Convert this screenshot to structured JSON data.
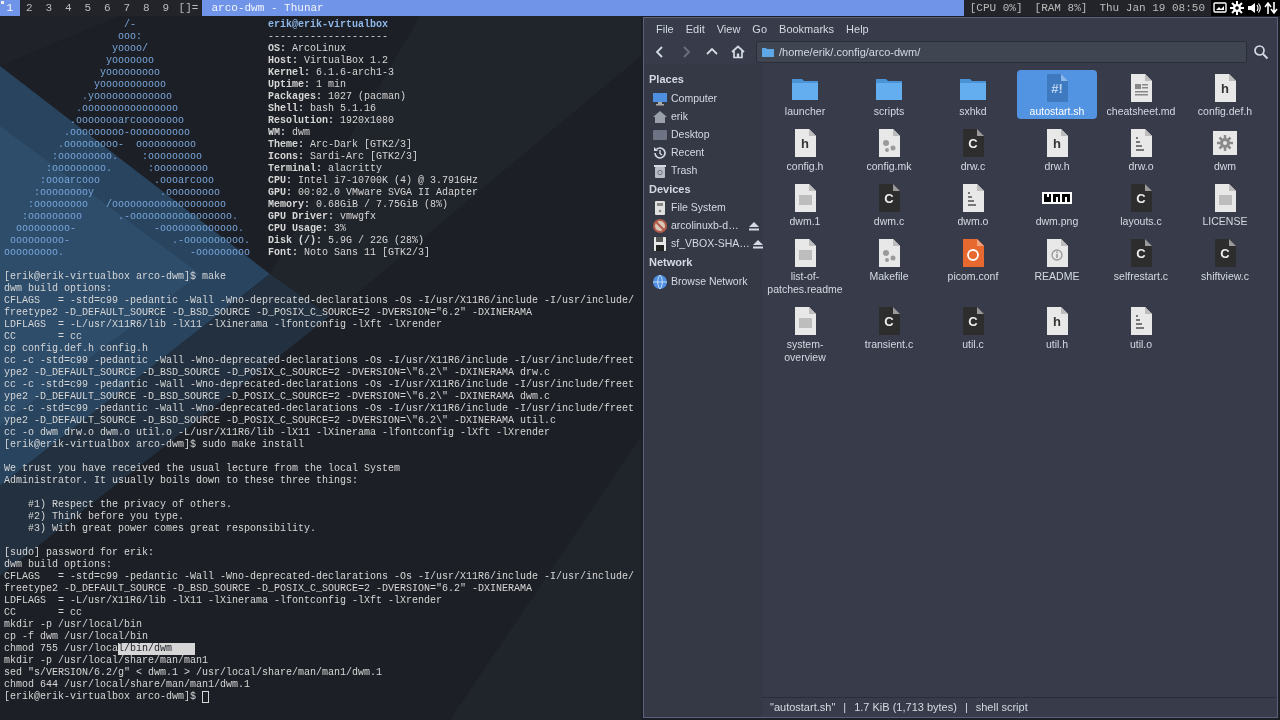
{
  "top_bar": {
    "tags": [
      {
        "label": "1",
        "selected": true,
        "occupied": true
      },
      {
        "label": "2",
        "selected": false,
        "occupied": false
      },
      {
        "label": "3",
        "selected": false,
        "occupied": false
      },
      {
        "label": "4",
        "selected": false,
        "occupied": false
      },
      {
        "label": "5",
        "selected": false,
        "occupied": false
      },
      {
        "label": "6",
        "selected": false,
        "occupied": false
      },
      {
        "label": "7",
        "selected": false,
        "occupied": false
      },
      {
        "label": "8",
        "selected": false,
        "occupied": false
      },
      {
        "label": "9",
        "selected": false,
        "occupied": false
      }
    ],
    "layout": "[]=",
    "window_title": "arco-dwm - Thunar",
    "status": [
      "[CPU 0%]",
      "[RAM 8%]",
      "Thu Jan 19 08:50"
    ],
    "tray": [
      {
        "kind": "screen"
      },
      {
        "kind": "gear"
      },
      {
        "kind": "volume"
      },
      {
        "kind": "network"
      }
    ]
  },
  "terminal": {
    "logo_lines": [
      "                    /-",
      "                   ooo:",
      "                  yoooo/",
      "                 yooooooo",
      "                yooooooooo",
      "               yooooooooooo",
      "             .yooooooooooooo",
      "            .oooooooooooooooo",
      "           .oooooooarcoooooooo",
      "          .ooooooooo-oooooooooo",
      "         .ooooooooo-  oooooooooo",
      "        :ooooooooo.    :ooooooooo",
      "       :ooooooooo.      :ooooooooo",
      "      :oooarcooo         .oooarcooo",
      "     :ooooooooy           .ooooooooo",
      "    :ooooooooo   /ooooooooooooooooooo",
      "   :ooooooooo      .-ooooooooooooooooo.",
      "  ooooooooo-             -ooooooooooooo.",
      " ooooooooo-                 .-oooooooooo.",
      "ooooooooo.                     -ooooooooo"
    ],
    "info_title": "erik@erik-virtualbox",
    "info_divider": "--------------------",
    "info_lines": [
      "**OS:** ArcoLinux",
      "**Host:** VirtualBox 1.2",
      "**Kernel:** 6.1.6-arch1-3",
      "**Uptime:** 1 min",
      "**Packages:** 1027 (pacman)",
      "**Shell:** bash 5.1.16",
      "**Resolution:** 1920x1080",
      "**WM:** dwm",
      "**Theme:** Arc-Dark [GTK2/3]",
      "**Icons:** Sardi-Arc [GTK2/3]",
      "**Terminal:** alacritty",
      "**CPU:** Intel i7-10700K (4) @ 3.791GHz",
      "**GPU:** 00:02.0 VMware SVGA II Adapter",
      "**Memory:** 0.68GiB / 7.75GiB (8%)",
      "**GPU Driver:** vmwgfx",
      "**CPU Usage:** 3%",
      "**Disk (/):** 5.9G / 22G (28%)",
      "**Font:** Noto Sans 11 [GTK2/3]"
    ],
    "blocks": [
      [
        "[erik@erik-virtualbox arco-dwm]$ make",
        "dwm build options:",
        "CFLAGS   = -std=c99 -pedantic -Wall -Wno-deprecated-declarations -Os -I/usr/X11R6/include -I/usr/include/",
        "freetype2 -D_DEFAULT_SOURCE -D_BSD_SOURCE -D_POSIX_C_SOURCE=2 -DVERSION=\"6.2\" -DXINERAMA",
        "LDFLAGS  = -L/usr/X11R6/lib -lX11 -lXinerama -lfontconfig -lXft -lXrender",
        "CC       = cc",
        "cp config.def.h config.h",
        "cc -c -std=c99 -pedantic -Wall -Wno-deprecated-declarations -Os -I/usr/X11R6/include -I/usr/include/freet",
        "ype2 -D_DEFAULT_SOURCE -D_BSD_SOURCE -D_POSIX_C_SOURCE=2 -DVERSION=\\\"6.2\\\" -DXINERAMA drw.c",
        "cc -c -std=c99 -pedantic -Wall -Wno-deprecated-declarations -Os -I/usr/X11R6/include -I/usr/include/freet",
        "ype2 -D_DEFAULT_SOURCE -D_BSD_SOURCE -D_POSIX_C_SOURCE=2 -DVERSION=\\\"6.2\\\" -DXINERAMA dwm.c",
        "cc -c -std=c99 -pedantic -Wall -Wno-deprecated-declarations -Os -I/usr/X11R6/include -I/usr/include/freet",
        "ype2 -D_DEFAULT_SOURCE -D_BSD_SOURCE -D_POSIX_C_SOURCE=2 -DVERSION=\\\"6.2\\\" -DXINERAMA util.c",
        "cc -o dwm drw.o dwm.o util.o -L/usr/X11R6/lib -lX11 -lXinerama -lfontconfig -lXft -lXrender",
        "[erik@erik-virtualbox arco-dwm]$ sudo make install"
      ],
      [
        "We trust you have received the usual lecture from the local System",
        "Administrator. It usually boils down to these three things:"
      ],
      [
        "    #1) Respect the privacy of others.",
        "    #2) Think before you type.",
        "    #3) With great power comes great responsibility."
      ],
      [
        "[sudo] password for erik:",
        "dwm build options:",
        "CFLAGS   = -std=c99 -pedantic -Wall -Wno-deprecated-declarations -Os -I/usr/X11R6/include -I/usr/include/",
        "freetype2 -D_DEFAULT_SOURCE -D_BSD_SOURCE -D_POSIX_C_SOURCE=2 -DVERSION=\"6.2\" -DXINERAMA",
        "LDFLAGS  = -L/usr/X11R6/lib -lX11 -lXinerama -lfontconfig -lXft -lXrender",
        "CC       = cc",
        "mkdir -p /usr/local/bin",
        "cp -f dwm /usr/local/bin",
        {
          "text": "chmod 755 /usr/loca",
          "selected_text": "l/bin/dwm"
        },
        "mkdir -p /usr/local/share/man/man1",
        "sed \"s/VERSION/6.2/g\" < dwm.1 > /usr/local/share/man/man1/dwm.1",
        "chmod 644 /usr/local/share/man/man1/dwm.1",
        {
          "text": "[erik@erik-virtualbox arco-dwm]$",
          "cursor": true
        }
      ]
    ]
  },
  "file_manager": {
    "menu": [
      "File",
      "Edit",
      "View",
      "Go",
      "Bookmarks",
      "Help"
    ],
    "toolbar": [
      {
        "kind": "back",
        "disabled": false
      },
      {
        "kind": "forward",
        "disabled": true
      },
      {
        "kind": "up",
        "disabled": false
      },
      {
        "kind": "home",
        "disabled": false
      }
    ],
    "path": "/home/erik/.config/arco-dwm/",
    "sidebar": [
      {
        "title": "Places",
        "items": [
          {
            "label": "Computer",
            "kind": "monitor",
            "selected": false,
            "ejectable": false
          },
          {
            "label": "erik",
            "kind": "home",
            "selected": false,
            "ejectable": false
          },
          {
            "label": "Desktop",
            "kind": "desktop",
            "selected": false,
            "ejectable": false
          },
          {
            "label": "Recent",
            "kind": "recent",
            "selected": false,
            "ejectable": false
          },
          {
            "label": "Trash",
            "kind": "trash",
            "selected": false,
            "ejectable": false
          }
        ]
      },
      {
        "title": "Devices",
        "items": [
          {
            "label": "File System",
            "kind": "drive",
            "selected": false,
            "ejectable": false
          },
          {
            "label": "arcolinuxb-d…",
            "kind": "disc",
            "selected": false,
            "ejectable": true
          },
          {
            "label": "sf_VBOX-SHA…",
            "kind": "floppy",
            "selected": false,
            "ejectable": true
          }
        ]
      },
      {
        "title": "Network",
        "items": [
          {
            "label": "Browse Network",
            "kind": "globe",
            "selected": false,
            "ejectable": false
          }
        ]
      }
    ],
    "files": [
      {
        "name": "launcher",
        "kind": "folder",
        "selected": false
      },
      {
        "name": "scripts",
        "kind": "folder",
        "selected": false
      },
      {
        "name": "sxhkd",
        "kind": "folder",
        "selected": false
      },
      {
        "name": "autostart.sh",
        "kind": "script",
        "icon_text": "#!",
        "selected": true
      },
      {
        "name": "cheatsheet.md",
        "kind": "document",
        "selected": false
      },
      {
        "name": "config.def.h",
        "kind": "header",
        "icon_text": "h",
        "selected": false
      },
      {
        "name": "config.h",
        "kind": "header",
        "icon_text": "h",
        "selected": false
      },
      {
        "name": "config.mk",
        "kind": "gears",
        "selected": false
      },
      {
        "name": "drw.c",
        "kind": "c",
        "icon_text": "C",
        "selected": false
      },
      {
        "name": "drw.h",
        "kind": "header",
        "icon_text": "h",
        "selected": false
      },
      {
        "name": "drw.o",
        "kind": "binary",
        "selected": false
      },
      {
        "name": "dwm",
        "kind": "executable",
        "selected": false
      },
      {
        "name": "dwm.1",
        "kind": "plain",
        "selected": false
      },
      {
        "name": "dwm.c",
        "kind": "c",
        "icon_text": "C",
        "selected": false
      },
      {
        "name": "dwm.o",
        "kind": "binary",
        "selected": false
      },
      {
        "name": "dwm.png",
        "selected": false
      },
      {
        "name": "layouts.c",
        "kind": "c",
        "icon_text": "C",
        "selected": false
      },
      {
        "name": "LICENSE",
        "kind": "plain",
        "selected": false
      },
      {
        "name": "list-of-patches.readme",
        "kind": "plain",
        "selected": false
      },
      {
        "name": "Makefile",
        "kind": "gears",
        "selected": false
      },
      {
        "name": "picom.conf",
        "kind": "config",
        "selected": false
      },
      {
        "name": "README",
        "kind": "info",
        "selected": false
      },
      {
        "name": "selfrestart.c",
        "kind": "c",
        "icon_text": "C",
        "selected": false
      },
      {
        "name": "shiftview.c",
        "kind": "c",
        "icon_text": "C",
        "selected": false
      },
      {
        "name": "system-overview",
        "kind": "plain",
        "selected": false
      },
      {
        "name": "transient.c",
        "kind": "c",
        "icon_text": "C",
        "selected": false
      },
      {
        "name": "util.c",
        "kind": "c",
        "icon_text": "C",
        "selected": false
      },
      {
        "name": "util.h",
        "kind": "header",
        "icon_text": "h",
        "selected": false
      },
      {
        "name": "util.o",
        "kind": "binary",
        "selected": false
      }
    ],
    "status_bar": [
      "\"autostart.sh\"",
      "|",
      "1.7 KiB (1,713 bytes)",
      "|",
      "shell script"
    ]
  }
}
